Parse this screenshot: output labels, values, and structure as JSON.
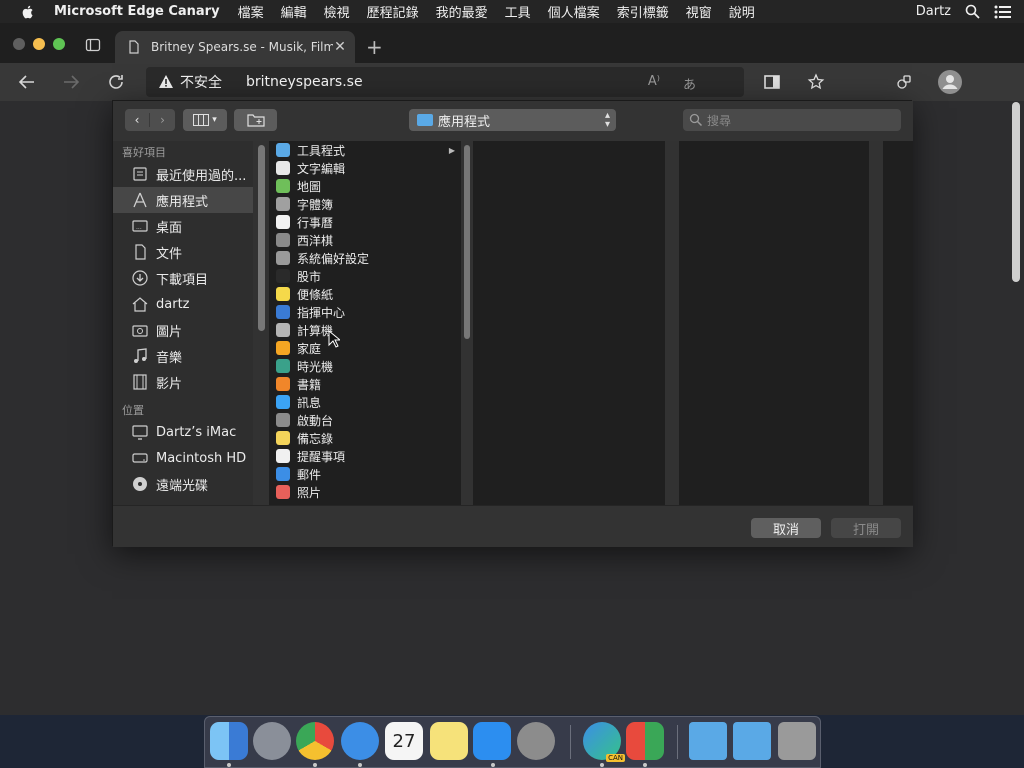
{
  "menubar": {
    "app_name": "Microsoft Edge Canary",
    "items": [
      "檔案",
      "編輯",
      "檢視",
      "歷程記錄",
      "我的最愛",
      "工具",
      "個人檔案",
      "索引標籤",
      "視窗",
      "說明"
    ],
    "user": "Dartz"
  },
  "browser": {
    "tab_title": "Britney Spears.se - Musik, Film",
    "security_label": "不安全",
    "url": "britneyspears.se",
    "read_aloud_glyph": "A⁾",
    "translate_glyph": "あ"
  },
  "dialog": {
    "location": "應用程式",
    "search_placeholder": "搜尋",
    "sidebar": {
      "favorites_header": "喜好項目",
      "favorites": [
        {
          "label": "最近使用過的...",
          "icon": "recents-icon"
        },
        {
          "label": "應用程式",
          "icon": "applications-icon"
        },
        {
          "label": "桌面",
          "icon": "desktop-icon"
        },
        {
          "label": "文件",
          "icon": "documents-icon"
        },
        {
          "label": "下載項目",
          "icon": "downloads-icon"
        },
        {
          "label": "dartz",
          "icon": "home-icon"
        },
        {
          "label": "圖片",
          "icon": "pictures-icon"
        },
        {
          "label": "音樂",
          "icon": "music-icon"
        },
        {
          "label": "影片",
          "icon": "movies-icon"
        }
      ],
      "locations_header": "位置",
      "locations": [
        {
          "label": "Dartz’s iMac",
          "icon": "imac-icon"
        },
        {
          "label": "Macintosh HD",
          "icon": "disk-icon"
        },
        {
          "label": "遠端光碟",
          "icon": "remote-disc-icon"
        }
      ]
    },
    "files": [
      {
        "name": "工具程式",
        "color": "#5aa9e6",
        "folder": true
      },
      {
        "name": "文字編輯",
        "color": "#e8e8e8"
      },
      {
        "name": "地圖",
        "color": "#6fbf5a"
      },
      {
        "name": "字體簿",
        "color": "#a0a0a0"
      },
      {
        "name": "行事曆",
        "color": "#f2f2f2"
      },
      {
        "name": "西洋棋",
        "color": "#8a8a8a"
      },
      {
        "name": "系統偏好設定",
        "color": "#9a9a9a"
      },
      {
        "name": "股市",
        "color": "#2a2a2a"
      },
      {
        "name": "便條紙",
        "color": "#f5d94a"
      },
      {
        "name": "指揮中心",
        "color": "#3a7bd5"
      },
      {
        "name": "計算機",
        "color": "#b5b5b5"
      },
      {
        "name": "家庭",
        "color": "#f5a623"
      },
      {
        "name": "時光機",
        "color": "#3aa18a"
      },
      {
        "name": "書籍",
        "color": "#f0862a"
      },
      {
        "name": "訊息",
        "color": "#3ba3f5"
      },
      {
        "name": "啟動台",
        "color": "#8c8c8c"
      },
      {
        "name": "備忘錄",
        "color": "#f3d35a"
      },
      {
        "name": "提醒事項",
        "color": "#f0f0f0"
      },
      {
        "name": "郵件",
        "color": "#3c8ee6"
      },
      {
        "name": "照片",
        "color": "#e8605a"
      }
    ],
    "cancel_label": "取消",
    "open_label": "打開"
  },
  "dock": {
    "calendar_day": "27",
    "badge_can": "CAN"
  },
  "colors": {
    "accent_blue": "#3c8ee6",
    "menubar_bg": "#252525",
    "dialog_bg": "#323232"
  }
}
